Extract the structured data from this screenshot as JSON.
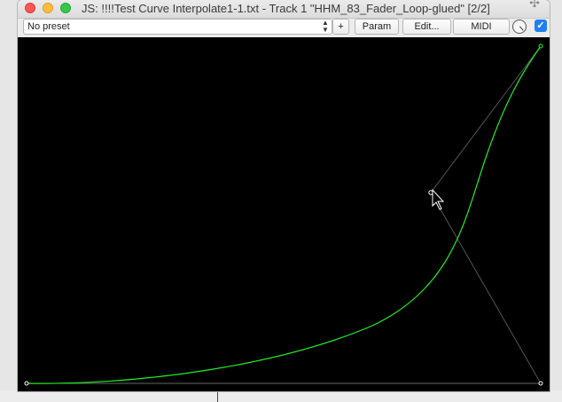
{
  "window": {
    "title": "JS: !!!!Test Curve Interpolate1-1.txt - Track 1 \"HHM_83_Fader_Loop-glued\" [2/2]"
  },
  "toolbar": {
    "preset_value": "No preset",
    "plus_label": "+",
    "param_label": "Param",
    "edit_label": "Edit...",
    "midi_label": "MIDI",
    "bypass_checked": true
  },
  "icons": {
    "close": "close-icon",
    "minimize": "minimize-icon",
    "maximize": "maximize-icon",
    "pin": "pin-icon",
    "chevron": "chevron-updown-icon",
    "knob": "wet-knob-icon",
    "cursor": "cursor-arrow-icon"
  },
  "colors": {
    "curve": "#22ee22",
    "control_line": "#555555",
    "handle": "#ffffff",
    "canvas_bg": "#000000",
    "checkbox": "#1e7ff6"
  }
}
